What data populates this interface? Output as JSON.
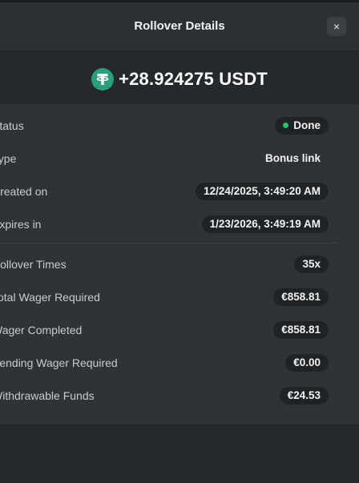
{
  "header": {
    "title": "Rollover Details",
    "close_label": "×"
  },
  "amount": {
    "text": "+28.924275 USDT",
    "icon": "tether-icon",
    "icon_color": "#26a17b"
  },
  "rows_top": [
    {
      "label": "Status",
      "value": "Done",
      "style": "status"
    },
    {
      "label": "Type",
      "value": "Bonus link",
      "style": "plain"
    },
    {
      "label": "Created on",
      "value": "12/24/2025, 3:49:20 AM",
      "style": "pill"
    },
    {
      "label": "Expires in",
      "value": "1/23/2026, 3:49:19 AM",
      "style": "pill"
    }
  ],
  "rows_bottom": [
    {
      "label": "Rollover Times",
      "value": "35x",
      "style": "pill"
    },
    {
      "label": "Total Wager Required",
      "value": "€858.81",
      "style": "pill"
    },
    {
      "label": "Wager Completed",
      "value": "€858.81",
      "style": "pill"
    },
    {
      "label": "Pending Wager Required",
      "value": "€0.00",
      "style": "pill"
    },
    {
      "label": "Withdrawable Funds",
      "value": "€24.53",
      "style": "pill"
    }
  ],
  "colors": {
    "status_done": "#22c55e",
    "background": "#1a1d1f",
    "card": "#303336"
  }
}
